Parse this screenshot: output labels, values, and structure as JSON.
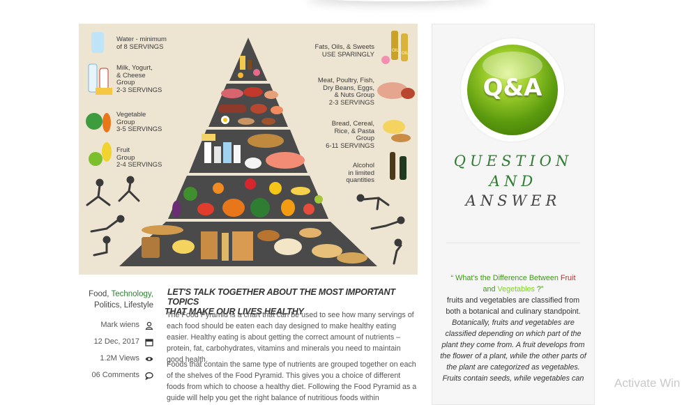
{
  "hero": {
    "left_labels": [
      {
        "lines": [
          "Water - minimum",
          "of 8 SERVINGS"
        ]
      },
      {
        "lines": [
          "Milk, Yogurt,",
          "& Cheese",
          "Group",
          "2-3 SERVINGS"
        ]
      },
      {
        "lines": [
          "Vegetable",
          "Group",
          "3-5 SERVINGS"
        ]
      },
      {
        "lines": [
          "Fruit",
          "Group",
          "2-4 SERVINGS"
        ]
      }
    ],
    "right_labels": [
      {
        "lines": [
          "Fats, Oils, & Sweets",
          "USE SPARINGLY"
        ]
      },
      {
        "lines": [
          "Meat, Poultry, Fish,",
          "Dry Beans, Eggs,",
          "& Nuts Group",
          "2-3 SERVINGS"
        ]
      },
      {
        "lines": [
          "Bread, Cereal,",
          "Rice, & Pasta",
          "Group",
          "6-11 SERVINGS"
        ]
      },
      {
        "lines": [
          "Alcohol",
          "in limited",
          "quantities"
        ]
      }
    ],
    "oil_label": "OIL"
  },
  "post": {
    "categories": {
      "first": "Food, ",
      "highlight": "Technology,",
      "second": "Politics, Lifestyle"
    },
    "meta": {
      "author": "Mark wiens",
      "date": "12 Dec, 2017",
      "views": "1.2M Views",
      "comments": "06 Comments"
    },
    "headline_line1": "LET'S TALK TOGETHER ABOUT THE MOST IMPORTANT TOPICS",
    "headline_line2": "THAT MAKE OUR LIVES HEALTHY",
    "paragraph1": "The Food Pyramid is a chart that can be used to see how many servings of each food should be eaten each day designed to make healthy eating easier. Healthy eating is about getting the correct amount of nutrients – protein, fat, carbohydrates, vitamins and minerals you need to maintain good health.",
    "paragraph2": "Foods that contain the same type of nutrients are grouped together on each of the shelves of the Food Pyramid. This gives you a choice of different foods from which to choose a healthy diet. Following the Food Pyramid as a guide will help you get the right balance of nutritious foods within"
  },
  "sidebar": {
    "qa_logo_text": "Q&A",
    "title_line1": "QUESTION",
    "title_line2": "AND",
    "title_line3": "ANSWER",
    "question_open": "“ What's the Difference Between ",
    "question_fruit": "Fruit",
    "question_and": "and ",
    "question_veg": "Vegetables",
    "question_close": " ?”",
    "answer_plain": "fruits and vegetables are classified from both a botanical and culinary standpoint. ",
    "answer_italic": "Botanically, fruits and vegetables are classified depending on which part of the plant they come from. A fruit develops from the flower of a plant, while the other parts of the plant are categorized as vegetables. Fruits contain seeds, while vegetables can"
  },
  "colors": {
    "accent_green": "#2e7d32",
    "question_green": "#3b9a15",
    "fruit_red": "#c62828",
    "vegetables_green": "#7ed321",
    "hero_background": "#eee4d2"
  },
  "icons": [
    "user-icon",
    "calendar-icon",
    "eye-icon",
    "comment-icon"
  ],
  "system": {
    "watermark": "Activate Win"
  }
}
